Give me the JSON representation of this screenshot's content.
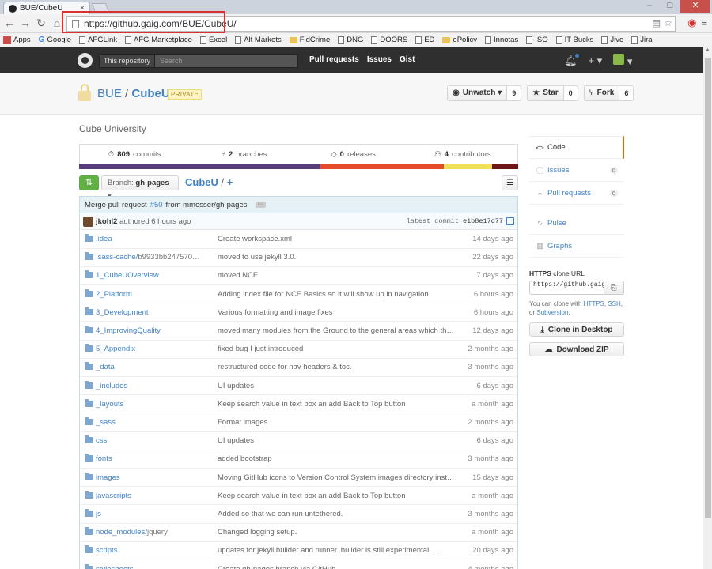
{
  "browser": {
    "tab_title": "BUE/CubeU",
    "url": "https://github.gaig.com/BUE/CubeU/",
    "bookmarks": [
      {
        "label": "Apps",
        "icon": "apps-grid-icon"
      },
      {
        "label": "Google",
        "icon": "google-icon"
      },
      {
        "label": "AFGLink",
        "icon": "page-icon"
      },
      {
        "label": "AFG Marketplace",
        "icon": "page-icon"
      },
      {
        "label": "Excel",
        "icon": "page-icon"
      },
      {
        "label": "Alt Markets",
        "icon": "page-icon"
      },
      {
        "label": "FidCrime",
        "icon": "folder-icon"
      },
      {
        "label": "DNG",
        "icon": "page-icon"
      },
      {
        "label": "DOORS",
        "icon": "page-icon"
      },
      {
        "label": "ED",
        "icon": "page-icon"
      },
      {
        "label": "ePolicy",
        "icon": "folder-icon"
      },
      {
        "label": "Innotas",
        "icon": "page-icon"
      },
      {
        "label": "ISO",
        "icon": "page-icon"
      },
      {
        "label": "IT Bucks",
        "icon": "page-icon"
      },
      {
        "label": "Jive",
        "icon": "page-icon"
      },
      {
        "label": "Jira",
        "icon": "page-icon"
      }
    ]
  },
  "header": {
    "search_scope": "This repository",
    "search_placeholder": "Search",
    "nav": [
      "Pull requests",
      "Issues",
      "Gist"
    ],
    "plus_label": "+ ▾"
  },
  "repo": {
    "owner": "BUE",
    "separator": "/",
    "name": "CubeU",
    "badge": "PRIVATE",
    "actions": [
      {
        "label": "Unwatch ▾",
        "icon": "eye-icon",
        "count": "9"
      },
      {
        "label": "Star",
        "icon": "star-icon",
        "count": "0"
      },
      {
        "label": "Fork",
        "icon": "fork-icon",
        "count": "6"
      }
    ],
    "description": "Cube University"
  },
  "summary": [
    {
      "icon": "history-icon",
      "num": "809",
      "label": "commits"
    },
    {
      "icon": "branch-icon",
      "num": "2",
      "label": "branches"
    },
    {
      "icon": "tag-icon",
      "num": "0",
      "label": "releases"
    },
    {
      "icon": "organization-icon",
      "num": "4",
      "label": "contributors"
    }
  ],
  "languages": [
    {
      "color": "#563d7c",
      "share": 55
    },
    {
      "color": "#e34c26",
      "share": 28
    },
    {
      "color": "#f1e05a",
      "share": 11
    },
    {
      "color": "#701516",
      "share": 6
    }
  ],
  "branch": {
    "prefix": "Branch:",
    "name": "gh-pages",
    "breadcrumb_repo": "CubeU",
    "breadcrumb_sep": "/",
    "breadcrumb_add": "+"
  },
  "commit": {
    "message": "Merge pull request",
    "pr": "#50",
    "message_rest": "from mmosser/gh-pages",
    "ellipsis": "···",
    "author": "jkohl2",
    "authored": "authored 6 hours ago",
    "latest_label": "latest commit",
    "sha": "e1b8e17d77"
  },
  "files": [
    {
      "name": ".idea",
      "muted": "",
      "message": "Create workspace.xml",
      "age": "14 days ago"
    },
    {
      "name": ".sass-cache/",
      "muted": "b9933bb247570…",
      "message": "moved to use jekyll 3.0.",
      "age": "22 days ago"
    },
    {
      "name": "1_CubeUOverview",
      "muted": "",
      "message": "moved NCE",
      "age": "7 days ago"
    },
    {
      "name": "2_Platform",
      "muted": "",
      "message": "Adding index file for NCE Basics so it will show up in navigation",
      "age": "6 hours ago"
    },
    {
      "name": "3_Development",
      "muted": "",
      "message": "Various formatting and image fixes",
      "age": "6 hours ago"
    },
    {
      "name": "4_ImprovingQuality",
      "muted": "",
      "message": "moved many modules from the Ground to the general areas which they be…",
      "age": "12 days ago"
    },
    {
      "name": "5_Appendix",
      "muted": "",
      "message": "fixed bug I just introduced",
      "age": "2 months ago"
    },
    {
      "name": "_data",
      "muted": "",
      "message": "restructured code for nav headers & toc.",
      "age": "3 months ago"
    },
    {
      "name": "_includes",
      "muted": "",
      "message": "UI updates",
      "age": "6 days ago"
    },
    {
      "name": "_layouts",
      "muted": "",
      "message": "Keep search value in text box an add Back to Top button",
      "age": "a month ago"
    },
    {
      "name": "_sass",
      "muted": "",
      "message": "Format images",
      "age": "2 months ago"
    },
    {
      "name": "css",
      "muted": "",
      "message": "UI updates",
      "age": "6 days ago"
    },
    {
      "name": "fonts",
      "muted": "",
      "message": "added bootstrap",
      "age": "3 months ago"
    },
    {
      "name": "images",
      "muted": "",
      "message": "Moving GitHub icons to Version Control System images directory instea…",
      "age": "15 days ago"
    },
    {
      "name": "javascripts",
      "muted": "",
      "message": "Keep search value in text box an add Back to Top button",
      "age": "a month ago"
    },
    {
      "name": "js",
      "muted": "",
      "message": "Added so that we can run untethered.",
      "age": "3 months ago"
    },
    {
      "name": "node_modules/",
      "muted": "jquery",
      "message": "Changed logging setup.",
      "age": "a month ago"
    },
    {
      "name": "scripts",
      "muted": "",
      "message": "updates for jekyll builder and runner. builder is still experimental …",
      "age": "20 days ago"
    },
    {
      "name": "stylesheets",
      "muted": "",
      "message": "Create gh-pages branch via GitHub",
      "age": "4 months ago"
    }
  ],
  "sidebar": {
    "nav": [
      {
        "label": "Code",
        "icon": "code-icon",
        "selected": true,
        "count": ""
      },
      {
        "label": "Issues",
        "icon": "issue-icon",
        "selected": false,
        "count": "0"
      },
      {
        "label": "Pull requests",
        "icon": "pull-request-icon",
        "selected": false,
        "count": "0"
      },
      {
        "label": "Pulse",
        "icon": "pulse-icon",
        "selected": false,
        "count": ""
      },
      {
        "label": "Graphs",
        "icon": "graph-icon",
        "selected": false,
        "count": ""
      }
    ],
    "clone_protocol": "HTTPS",
    "clone_suffix": "clone URL",
    "clone_url": "https://github.gaig",
    "clone_help_prefix": "You can clone with",
    "clone_help_https": "HTTPS",
    "clone_help_ssh": "SSH",
    "clone_help_or": ", or",
    "clone_help_subversion": "Subversion",
    "clone_desktop": "Clone in Desktop",
    "download_zip": "Download ZIP"
  }
}
